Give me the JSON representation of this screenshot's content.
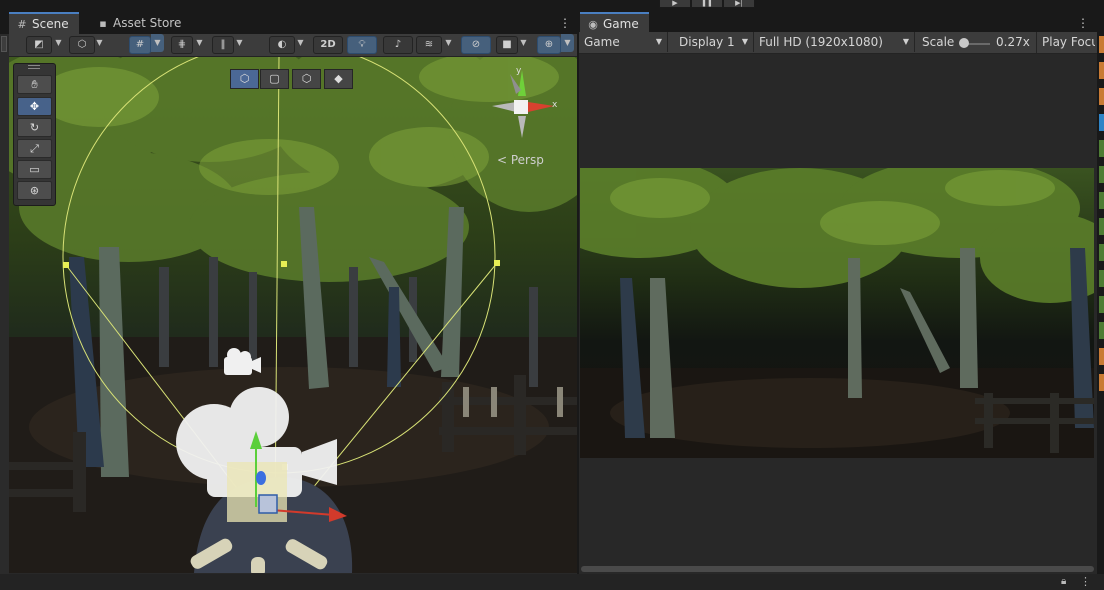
{
  "play_controls": {
    "play": "▶",
    "pause": "❚❚",
    "step": "▶|"
  },
  "scene_panel": {
    "tabs": [
      {
        "label": "Scene",
        "icon": "grid-icon"
      },
      {
        "label": "Asset Store",
        "icon": "shopping-bag-icon"
      }
    ],
    "toolbar": {
      "mode_2d": "2D",
      "persp_label": "< Persp",
      "gizmo_axes": {
        "y": "y",
        "x": "x"
      }
    },
    "tools": [
      "hand-tool",
      "move-tool",
      "rotate-tool",
      "scale-tool",
      "rect-tool",
      "transform-tool"
    ],
    "active_tool": "move-tool"
  },
  "game_panel": {
    "tab": {
      "label": "Game",
      "icon": "gamepad-icon"
    },
    "toolbar": {
      "view_select": "Game",
      "display_select": "Display 1",
      "resolution_select": "Full HD (1920x1080)",
      "scale_label": "Scale",
      "scale_value": "0.27x",
      "play_focus": "Play Focu"
    }
  },
  "colors": {
    "accent": "#4a7fc1",
    "panel_bg": "#282828",
    "toolbar_bg": "#3c3c3c",
    "edge_marks": [
      "#c97b34",
      "#c97b34",
      "#c97b34",
      "#2e84c7",
      "#4e7d34",
      "#4e7d34",
      "#4e7d34",
      "#4e7d34",
      "#4e7d34",
      "#4e7d34",
      "#4e7d34",
      "#4e7d34",
      "#c97b34",
      "#c97b34"
    ]
  }
}
